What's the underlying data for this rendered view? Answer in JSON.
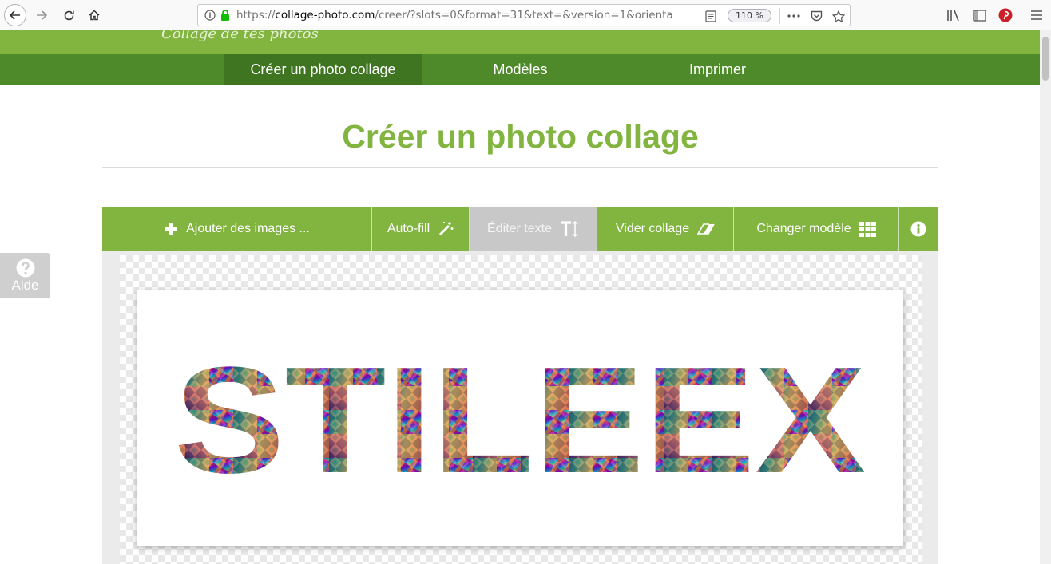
{
  "browser": {
    "url_prefix": "https://",
    "url_host": "collage-photo.com",
    "url_path": "/creer/?slots=0&format=31&text=&version=1&orientat",
    "zoom": "110 %"
  },
  "site": {
    "logo_text": "Collage de tes photos",
    "nav": [
      {
        "label": "Créer un photo collage",
        "active": true
      },
      {
        "label": "Modèles",
        "active": false
      },
      {
        "label": "Imprimer",
        "active": false
      }
    ]
  },
  "main": {
    "title": "Créer un photo collage"
  },
  "toolbar": {
    "add_images": "Ajouter des images ...",
    "auto_fill": "Auto-fill",
    "edit_text": "Éditer texte",
    "clear_collage": "Vider collage",
    "change_template": "Changer modèle"
  },
  "help": {
    "label": "Aide"
  },
  "collage": {
    "text": "STILEEX"
  },
  "colors": {
    "brand_green": "#82b440",
    "nav_green": "#4e8a2a",
    "disabled_gray": "#c8c8c8"
  }
}
